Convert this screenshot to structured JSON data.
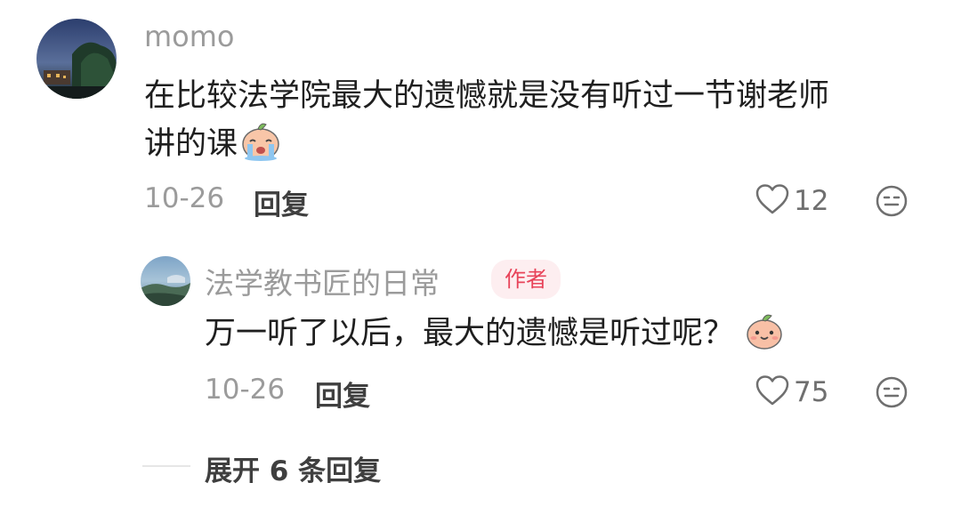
{
  "comments": [
    {
      "username": "momo",
      "text_line1": "在比较法学院最大的遗憾就是没有听过一节谢老师",
      "text_line2": "讲的课",
      "emoji": "crying-face-emoji",
      "date": "10-26",
      "reply_label": "回复",
      "likes": "12",
      "reaction_icon": "meh-face-icon",
      "replies": [
        {
          "username": "法学教书匠的日常",
          "badge": "作者",
          "text": "万一听了以后，最大的遗憾是听过呢？",
          "emoji": "smiling-peach-emoji",
          "date": "10-26",
          "reply_label": "回复",
          "likes": "75",
          "reaction_icon": "meh-face-icon"
        }
      ],
      "expand_label": "展开 6 条回复"
    }
  ],
  "colors": {
    "username": "#9b9b9b",
    "text": "#1f1f1f",
    "badge_bg": "#fdeef0",
    "badge_text": "#e8445a"
  }
}
